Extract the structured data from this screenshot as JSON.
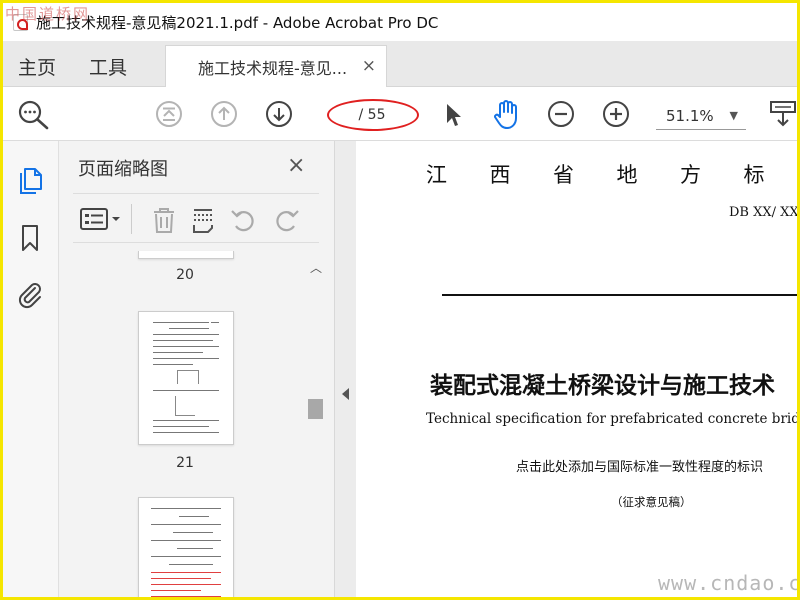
{
  "window": {
    "title": "施工技术规程-意见稿2021.1.pdf - Adobe Acrobat Pro DC",
    "watermark_tl": "中国道桥网"
  },
  "tabs": {
    "home": "主页",
    "tools": "工具",
    "doc_tab": "施工技术规程-意见...",
    "close": "×"
  },
  "toolbar": {
    "page_indicator": "/ 55",
    "zoom_value": "51.1%"
  },
  "thumbnails": {
    "title": "页面缩略图",
    "close": "×",
    "page_numbers": [
      "20",
      "21"
    ]
  },
  "document": {
    "header_chars": [
      "江",
      "西",
      "省",
      "地",
      "方",
      "标"
    ],
    "db_code": "DB XX/ XX",
    "title_cn": "装配式混凝土桥梁设计与施工技术",
    "title_en": "Technical specification for prefabricated concrete bridge design and",
    "note": "点击此处添加与国际标准一致性程度的标识",
    "draft": "（征求意见稿）"
  },
  "watermark_br": "www.cndao.com",
  "colors": {
    "accent_blue": "#1473e6",
    "annotation_red": "#e02020",
    "border_yellow": "#f5e600"
  }
}
